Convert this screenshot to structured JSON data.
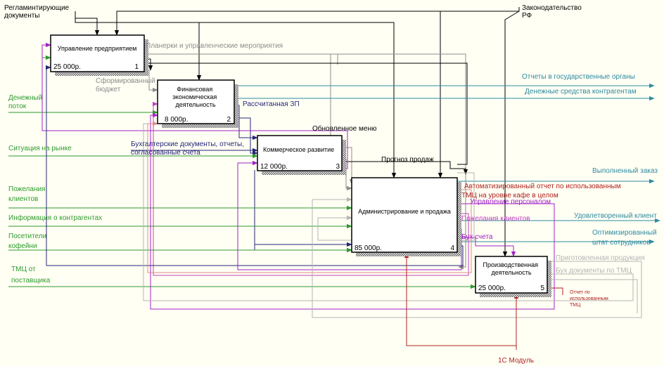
{
  "colors": {
    "background": "#fffff4",
    "black": "#000000",
    "gray": "#8c8c8c",
    "light_gray": "#b4b4b4",
    "green": "#2e9a2e",
    "purple": "#a022c8",
    "magenta": "#c040c0",
    "dark_blue": "#25257a",
    "teal": "#2f8aa0",
    "red": "#b02020",
    "pink": "#e08a8a"
  },
  "boxes": [
    {
      "id": "b1",
      "title": [
        "Управление предприятием"
      ],
      "cost": "25 000р.",
      "num": "1"
    },
    {
      "id": "b2",
      "title": [
        "Финансовая",
        "экономическая",
        "деятельность"
      ],
      "cost": "8 000р.",
      "num": "2"
    },
    {
      "id": "b3",
      "title": [
        "Коммерческое развитие"
      ],
      "cost": "12 000р.",
      "num": "3"
    },
    {
      "id": "b4",
      "title": [
        "Администрирование и продажа"
      ],
      "cost": "85 000р.",
      "num": "4"
    },
    {
      "id": "b5",
      "title": [
        "Производственная",
        "деятельность"
      ],
      "cost": "25 000р.",
      "num": "5"
    }
  ],
  "labels": {
    "reg_docs": [
      "Регламинтирующие",
      "документы"
    ],
    "law": [
      "Законодательство",
      "РФ"
    ],
    "meetings": "Планерки и управленческие мероприятия",
    "budget": [
      "Сформированный",
      "бюджет"
    ],
    "calc_salary": "Рассчитанная ЗП",
    "updated_menu": "Обновленное меню",
    "acc_docs": [
      "Бухгалтерские документы, отчеты,",
      "согласованные счета"
    ],
    "sales_forecast": "Прогноз продаж",
    "cash_flow": [
      "Денежный",
      "поток"
    ],
    "market": "Ситуация на рынке",
    "client_wishes": [
      "Пожелания",
      "клиентов"
    ],
    "contractor_info": "Информация о контрагентах",
    "visitors": [
      "Посетители",
      "кофейни"
    ],
    "tmc_supplier": [
      "ТМЦ от",
      "поставщика"
    ],
    "reports_gov": "Отчеты в государственные органы",
    "money_contractors": "Денежные средства контрагентам",
    "completed_order": "Выполненный заказ",
    "auto_report": [
      "Автоматизированный отчет по использованным",
      "ТМЦ на уровне кафе в целом"
    ],
    "staff_mgmt": "Управление персоналом",
    "satisfied_client": "Удовлетворенный клиент",
    "client_wishes_out": "Пожелания клиентов",
    "optimized_staff": [
      "Оптимизированный",
      "штат сотрудников"
    ],
    "bills": "Бух счета",
    "prepared_products": "Приготовленная продукция",
    "acc_docs_tmc": "Бух документы по ТМЦ",
    "report_used_tmc": [
      "Отчет по",
      "использованным",
      "ТМЦ"
    ],
    "module_1c": "1С Модуль"
  }
}
